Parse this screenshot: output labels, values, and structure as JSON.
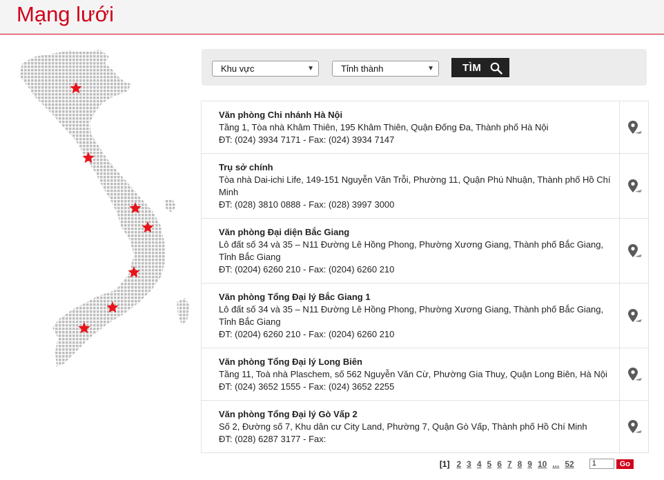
{
  "page": {
    "title": "Mạng lưới"
  },
  "search": {
    "region_placeholder": "Khu vực",
    "province_placeholder": "Tỉnh thành",
    "button_label": "TÌM"
  },
  "offices": [
    {
      "name": "Văn phòng Chi nhánh Hà Nội",
      "address": "Tầng 1, Tòa nhà Khâm Thiên, 195 Khâm Thiên, Quận Đống Đa, Thành phố Hà Nội",
      "contact": "ĐT: (024) 3934 7171 - Fax: (024) 3934 7147"
    },
    {
      "name": "Trụ sở chính",
      "address": "Tòa nhà Dai-ichi Life, 149-151 Nguyễn Văn Trỗi, Phường 11, Quận Phú Nhuận, Thành phố Hồ Chí Minh",
      "contact": "ĐT: (028) 3810 0888 - Fax: (028) 3997 3000"
    },
    {
      "name": "Văn phòng Đại diện Bắc Giang",
      "address": "Lô đất số 34 và 35 – N11 Đường Lê Hồng Phong, Phường Xương Giang, Thành phố Bắc Giang, Tỉnh Bắc Giang",
      "contact": "ĐT: (0204) 6260 210 - Fax: (0204) 6260 210"
    },
    {
      "name": "Văn phòng Tổng Đại lý Bắc Giang 1",
      "address": "Lô đất số 34 và 35 – N11 Đường Lê Hồng Phong, Phường Xương Giang, Thành phố Bắc Giang, Tỉnh Bắc Giang",
      "contact": "ĐT: (0204) 6260 210 - Fax: (0204) 6260 210"
    },
    {
      "name": "Văn phòng Tổng Đại lý Long Biên",
      "address": "Tầng 11, Toà nhà Plaschem, số 562 Nguyễn Văn Cừ, Phường Gia Thuỵ, Quận Long Biên, Hà Nội",
      "contact": "ĐT: (024) 3652 1555 - Fax: (024) 3652 2255"
    },
    {
      "name": "Văn phòng Tổng Đại lý Gò Vấp 2",
      "address": "Số 2, Đường số 7, Khu dân cư City Land, Phường 7, Quận Gò Vấp, Thành phố Hồ Chí Minh",
      "contact": "ĐT: (028) 6287 3177 - Fax:"
    }
  ],
  "pagination": {
    "current": "[1]",
    "pages": [
      "2",
      "3",
      "4",
      "5",
      "6",
      "7",
      "8",
      "9",
      "10",
      "...",
      "52"
    ],
    "input_value": "1",
    "go_label": "Go"
  },
  "colors": {
    "accent": "#d0021b",
    "map_dots": "#bdbdbd",
    "star": "#e8141b"
  },
  "icons": {
    "search": "magnifier-icon",
    "pin": "map-pin-icon",
    "star": "star-icon"
  }
}
